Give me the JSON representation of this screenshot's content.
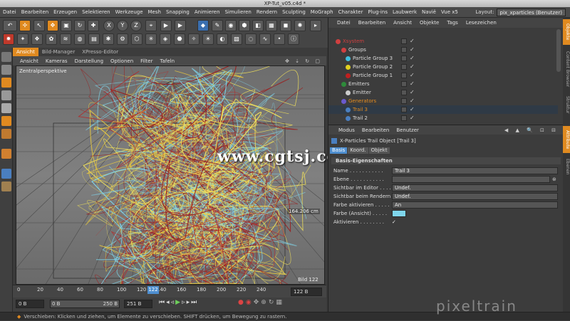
{
  "window": {
    "title": "XP-Tut_v05.c4d *"
  },
  "menubar": {
    "items": [
      "Datei",
      "Bearbeiten",
      "Erzeugen",
      "Selektieren",
      "Werkzeuge",
      "Mesh",
      "Snapping",
      "Animieren",
      "Simulieren",
      "Rendern",
      "Sculpting",
      "MoGraph",
      "Charakter",
      "Plug-ins",
      "Laubwerk",
      "Navië",
      "Vue x5"
    ],
    "layout_label": "Layout:",
    "layout_value": "pix_xparticles (Benutzer)"
  },
  "toolbar": {
    "xyz": [
      "X",
      "Y",
      "Z"
    ]
  },
  "viewport": {
    "tabs": [
      "Ansicht",
      "Bild-Manager",
      "XPresso-Editor"
    ],
    "menu": [
      "Ansicht",
      "Kameras",
      "Darstellung",
      "Optionen",
      "Filter",
      "Tafeln"
    ],
    "camera_label": "Zentralperspektive",
    "distance_readout": "164.206 cm",
    "frame_label": "Bild",
    "frame_value": "122"
  },
  "timeline": {
    "ticks": [
      "0",
      "20",
      "40",
      "60",
      "80",
      "100",
      "120",
      "140",
      "160",
      "180",
      "200",
      "220",
      "240"
    ],
    "current_frame": "122",
    "current_frame_field": "122 B",
    "start_field": "0 B",
    "min_field": "0 B",
    "max_field": "250 B",
    "end_field": "251 B"
  },
  "object_manager": {
    "menu": [
      "Datei",
      "Bearbeiten",
      "Ansicht",
      "Objekte",
      "Tags",
      "Lesezeichen"
    ],
    "rows": [
      {
        "label": "Xsystem",
        "color": "#d04040",
        "indent": 0
      },
      {
        "label": "Groups",
        "color": "#e0e0e0",
        "indent": 1
      },
      {
        "label": "Particle Group 3",
        "color": "#40c0e0",
        "indent": 2
      },
      {
        "label": "Particle Group 2",
        "color": "#e0d020",
        "indent": 2
      },
      {
        "label": "Particle Group 1",
        "color": "#c02020",
        "indent": 2
      },
      {
        "label": "Emitters",
        "color": "#e0e0e0",
        "indent": 1
      },
      {
        "label": "Emitter",
        "color": "#e0e0e0",
        "indent": 2
      },
      {
        "label": "Generators",
        "color": "#e08a20",
        "indent": 1
      },
      {
        "label": "Trail 3",
        "color": "#e08a20",
        "indent": 2
      },
      {
        "label": "Trail 2",
        "color": "#e0e0e0",
        "indent": 2
      }
    ]
  },
  "attribute_manager": {
    "menu": [
      "Modus",
      "Bearbeiten",
      "Benutzer"
    ],
    "object_title": "X-Particles Trail Object [Trail 3]",
    "tabs": [
      "Basis",
      "Koord.",
      "Objekt"
    ],
    "section": "Basis-Eigenschaften",
    "fields": [
      {
        "key": "Name . . . . . . . . . . .",
        "value": "Trail 3"
      },
      {
        "key": "Ebene . . . . . . . . . . .",
        "value": ""
      },
      {
        "key": "Sichtbar im Editor . . . .",
        "value": "Undef."
      },
      {
        "key": "Sichtbar beim Rendern . .",
        "value": "Undef."
      },
      {
        "key": "Farbe aktivieren . . . . .",
        "value": "An"
      },
      {
        "key": "Farbe (Ansicht) . . . . .",
        "value": ""
      },
      {
        "key": "Aktivieren . . . . . . . .",
        "value": "✓"
      }
    ],
    "display_color": "#7fd6ec"
  },
  "right_tabs": [
    "Objekte",
    "Content Browser",
    "Struktur",
    "Attribute",
    "Ebenen"
  ],
  "statusbar": {
    "text": "Verschieben: Klicken und ziehen, um Elemente zu verschieben. SHIFT drücken, um Bewegung zu rastern."
  },
  "watermark": {
    "text": "www.cgtsj.com"
  },
  "brand": {
    "text": "pixeltrain"
  },
  "colors": {
    "accent": "#e08a20",
    "trail_yellow": "#f2e25a",
    "trail_red": "#9a1e1e",
    "trail_cyan": "#7fd6ec"
  }
}
